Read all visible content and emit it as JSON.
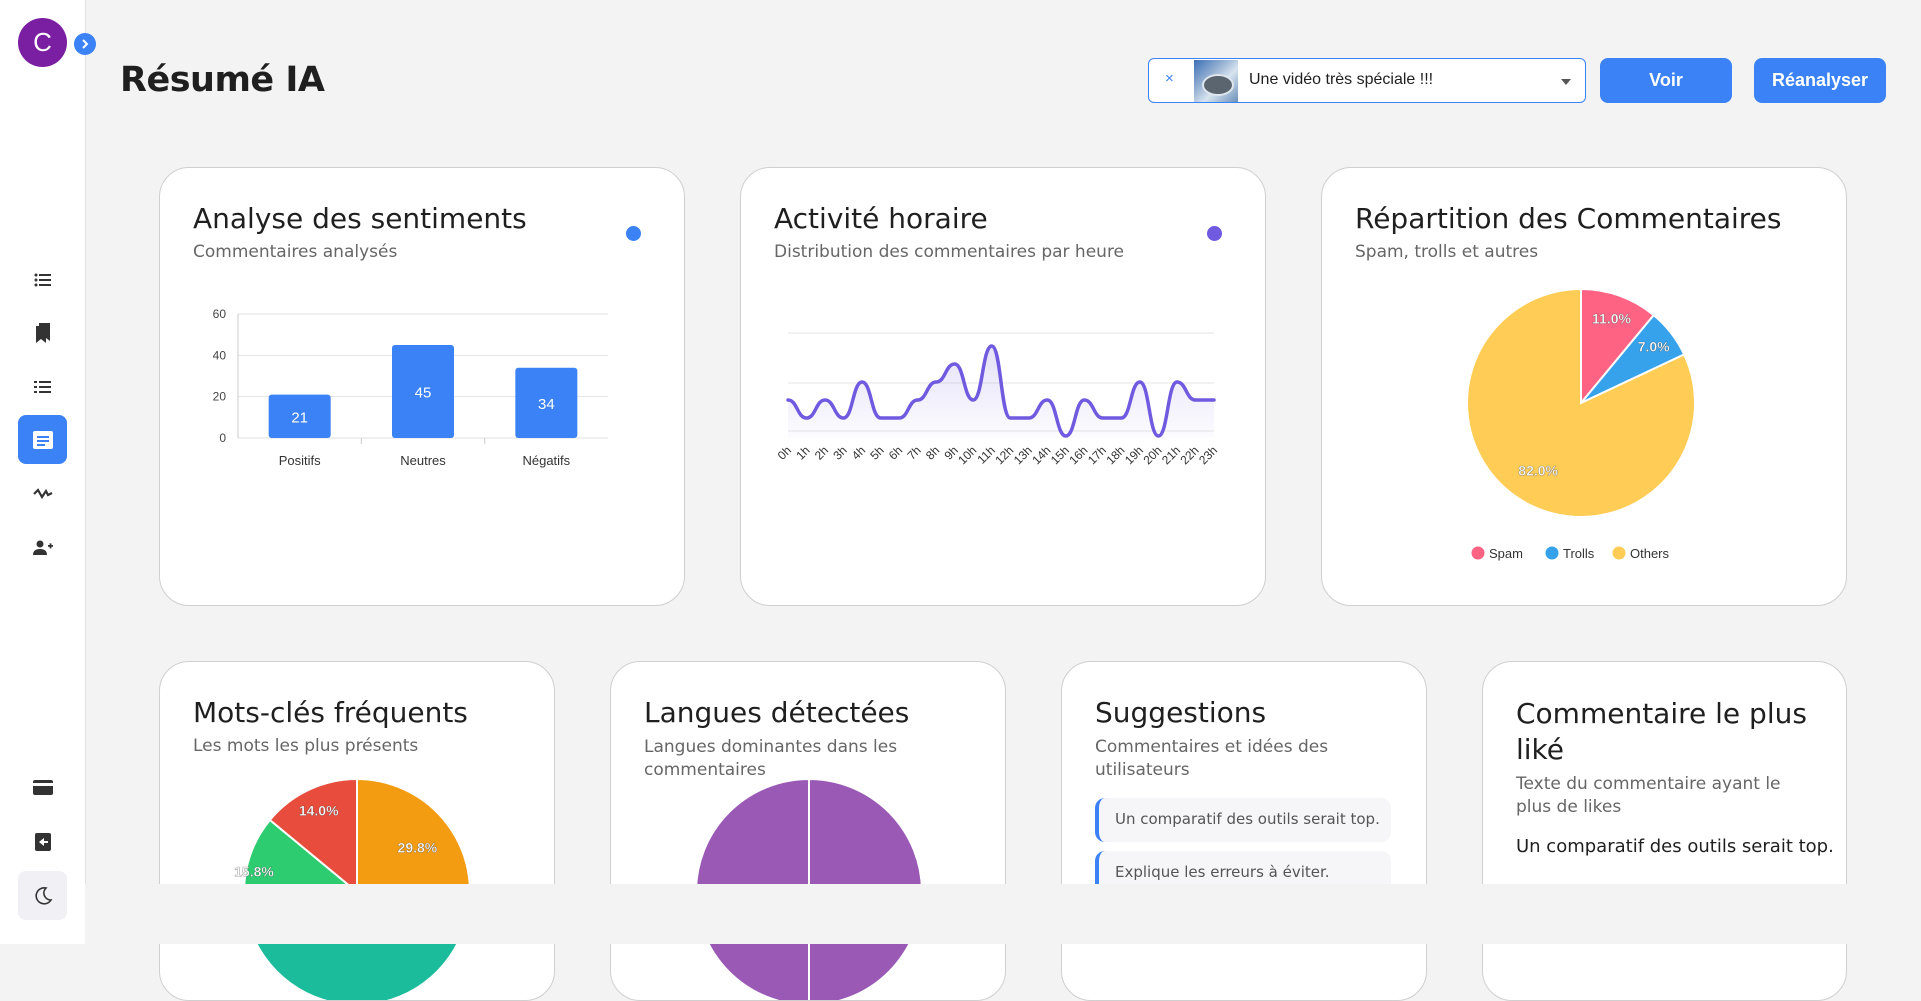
{
  "sidebar": {
    "avatar_letter": "C",
    "items": [
      {
        "icon": "list-icon"
      },
      {
        "icon": "bookmarks-icon"
      },
      {
        "icon": "ordered-list-icon"
      },
      {
        "icon": "summary-icon",
        "active": true
      },
      {
        "icon": "activity-icon"
      },
      {
        "icon": "add-user-icon"
      }
    ],
    "bottom_items": [
      {
        "icon": "credit-card-icon"
      },
      {
        "icon": "logout-icon"
      },
      {
        "icon": "moon-icon"
      }
    ]
  },
  "header": {
    "title": "Résumé IA",
    "video_select": {
      "clear": "×",
      "value": "Une vidéo très spéciale !!!"
    },
    "view_button": "Voir",
    "reanalyze_button": "Réanalyser"
  },
  "colors": {
    "accent": "#3b82f6",
    "line": "#6f5ae0",
    "spam": "#ff6384",
    "trolls": "#36a2eb",
    "others": "#ffcd56",
    "kw_orange": "#f39c12",
    "kw_red": "#e74c3c",
    "kw_green": "#2ecc71",
    "lang_purple": "#9b59b6"
  },
  "cards": {
    "sentiment": {
      "title": "Analyse des sentiments",
      "subtitle": "Commentaires analysés"
    },
    "hourly": {
      "title": "Activité horaire",
      "subtitle": "Distribution des commentaires par heure"
    },
    "distribution": {
      "title": "Répartition des Commentaires",
      "subtitle": "Spam, trolls et autres"
    },
    "keywords": {
      "title": "Mots-clés fréquents",
      "subtitle": "Les mots les plus présents"
    },
    "languages": {
      "title": "Langues détectées",
      "subtitle": "Langues dominantes dans les commentaires"
    },
    "suggestions": {
      "title": "Suggestions",
      "subtitle": "Commentaires et idées des utilisateurs",
      "items": [
        "Un comparatif des outils serait top.",
        "Explique les erreurs à éviter."
      ]
    },
    "most_liked": {
      "title": "Commentaire le plus liké",
      "subtitle": "Texte du commentaire ayant le plus de likes",
      "text": "Un comparatif des outils serait top."
    }
  },
  "chart_data": [
    {
      "type": "bar",
      "categories": [
        "Positifs",
        "Neutres",
        "Négatifs"
      ],
      "values": [
        21,
        45,
        34
      ],
      "ylim": [
        0,
        60
      ],
      "yticks": [
        0,
        20,
        40,
        60
      ],
      "data_labels": [
        "21",
        "45",
        "34"
      ],
      "grid": true
    },
    {
      "type": "area",
      "categories": [
        "0h",
        "1h",
        "2h",
        "3h",
        "4h",
        "5h",
        "6h",
        "7h",
        "8h",
        "9h",
        "10h",
        "11h",
        "12h",
        "13h",
        "14h",
        "15h",
        "16h",
        "17h",
        "18h",
        "19h",
        "20h",
        "21h",
        "22h",
        "23h"
      ],
      "values": [
        2,
        1,
        2,
        1,
        3,
        1,
        1,
        2,
        3,
        4,
        2,
        5,
        1,
        1,
        2,
        0,
        2,
        1,
        1,
        3,
        0,
        3,
        2,
        2
      ],
      "ylim": [
        0,
        5
      ],
      "grid": true
    },
    {
      "type": "pie",
      "labels": [
        "Spam",
        "Trolls",
        "Others"
      ],
      "values": [
        11.0,
        7.0,
        82.0
      ],
      "data_labels": [
        "11.0%",
        "7.0%",
        "82.0%"
      ],
      "legend": "bottom"
    },
    {
      "type": "pie",
      "values": [
        29.8,
        15.8,
        14.0
      ],
      "data_labels": [
        "29.8%",
        "15.8%",
        "14.0%"
      ]
    },
    {
      "type": "pie",
      "values": [
        50,
        50
      ]
    }
  ]
}
